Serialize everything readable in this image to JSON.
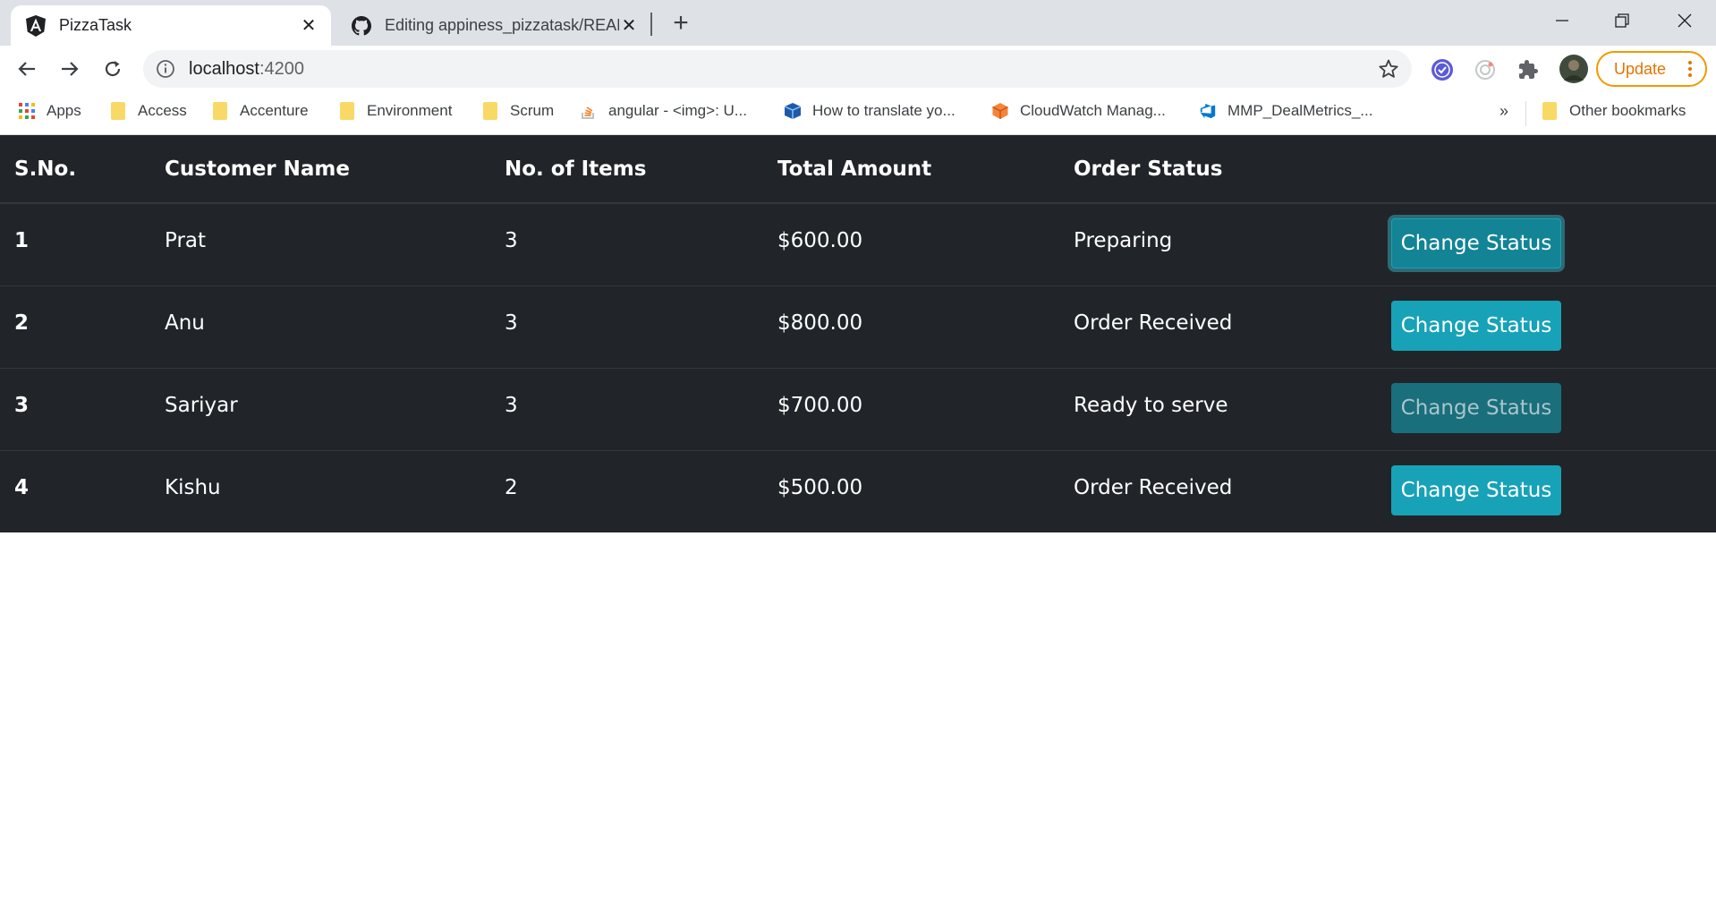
{
  "browser": {
    "tabs": [
      {
        "title": "PizzaTask",
        "favicon": "angular-icon",
        "active": true
      },
      {
        "title": "Editing appiness_pizzatask/READ",
        "favicon": "github-icon",
        "active": false
      }
    ],
    "new_tab_label": "+",
    "address": {
      "host": "localhost",
      "port": ":4200"
    },
    "update_label": "Update",
    "bookmarks": [
      {
        "label": "Apps",
        "icon": "apps-grid-icon"
      },
      {
        "label": "Access",
        "icon": "folder-icon"
      },
      {
        "label": "Accenture",
        "icon": "folder-icon"
      },
      {
        "label": "Environment",
        "icon": "folder-icon"
      },
      {
        "label": "Scrum",
        "icon": "folder-icon"
      },
      {
        "label": "angular - <img>: U...",
        "icon": "stackoverflow-icon"
      },
      {
        "label": "How to translate yo...",
        "icon": "cube-icon"
      },
      {
        "label": "CloudWatch Manag...",
        "icon": "aws-icon"
      },
      {
        "label": "MMP_DealMetrics_...",
        "icon": "azure-devops-icon"
      }
    ],
    "bookmarks_overflow": "»",
    "other_bookmarks": "Other bookmarks"
  },
  "orders_table": {
    "headers": [
      "S.No.",
      "Customer Name",
      "No. of Items",
      "Total Amount",
      "Order Status"
    ],
    "rows": [
      {
        "sno": "1",
        "customer": "Prat",
        "items": "3",
        "amount": "$600.00",
        "status": "Preparing",
        "action": "Change Status"
      },
      {
        "sno": "2",
        "customer": "Anu",
        "items": "3",
        "amount": "$800.00",
        "status": "Order Received",
        "action": "Change Status"
      },
      {
        "sno": "3",
        "customer": "Sariyar",
        "items": "3",
        "amount": "$700.00",
        "status": "Ready to serve",
        "action": "Change Status"
      },
      {
        "sno": "4",
        "customer": "Kishu",
        "items": "2",
        "amount": "$500.00",
        "status": "Order Received",
        "action": "Change Status"
      }
    ]
  },
  "colors": {
    "table_bg": "#212529",
    "button_bg": "#17a2b8",
    "tabstrip_bg": "#dee1e6",
    "update_accent": "#e37400"
  }
}
